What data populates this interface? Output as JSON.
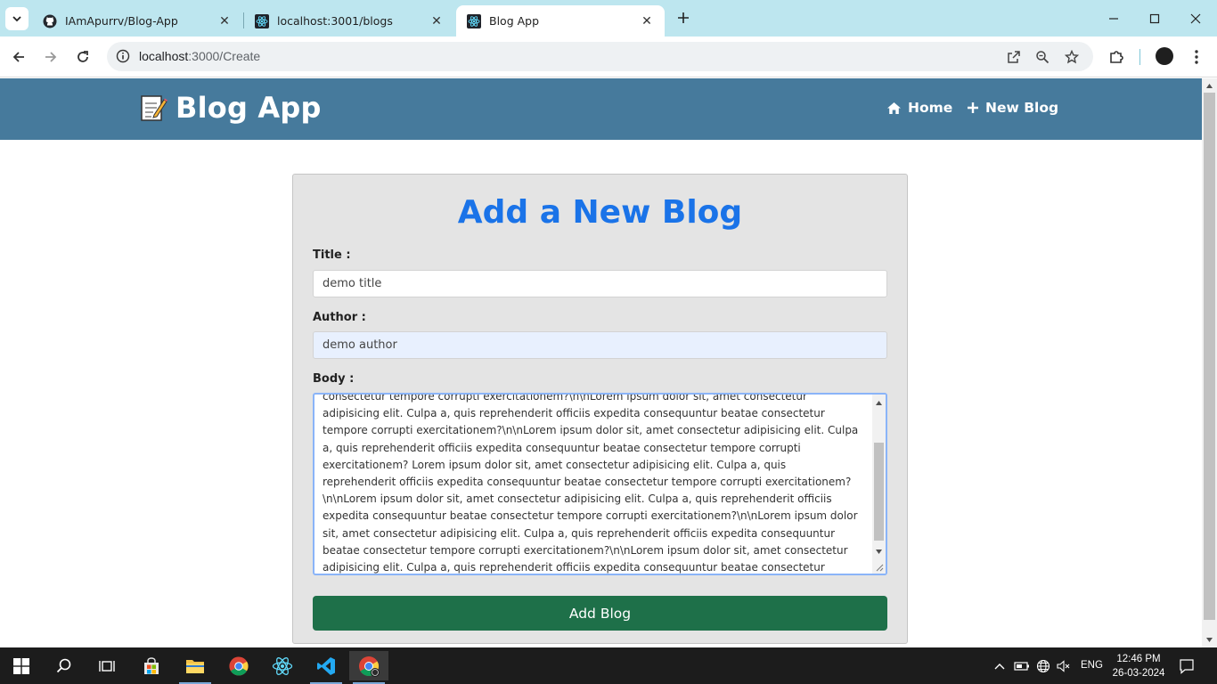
{
  "browser": {
    "tabs": [
      {
        "title": "IAmApurrv/Blog-App",
        "icon": "github-icon",
        "active": false
      },
      {
        "title": "localhost:3001/blogs",
        "icon": "react-icon",
        "active": false
      },
      {
        "title": "Blog App",
        "icon": "react-icon",
        "active": true
      }
    ],
    "address": {
      "host": "localhost",
      "path": ":3000/Create"
    }
  },
  "app": {
    "brand": "Blog App",
    "brand_icon": "memo-emoji-icon",
    "nav": [
      {
        "label": "Home",
        "icon": "home-icon"
      },
      {
        "label": "New Blog",
        "icon": "plus-icon"
      }
    ]
  },
  "form": {
    "heading": "Add a New Blog",
    "title_label": "Title :",
    "title_value": "demo title",
    "author_label": "Author :",
    "author_value": "demo author",
    "body_label": "Body :",
    "body_value": "consectetur tempore corrupti exercitationem?\\n\\nLorem ipsum dolor sit, amet consectetur adipisicing elit. Culpa a, quis reprehenderit officiis expedita consequuntur beatae consectetur tempore corrupti exercitationem?\\n\\nLorem ipsum dolor sit, amet consectetur adipisicing elit. Culpa a, quis reprehenderit officiis expedita consequuntur beatae consectetur tempore corrupti exercitationem? Lorem ipsum dolor sit, amet consectetur adipisicing elit. Culpa a, quis reprehenderit officiis expedita consequuntur beatae consectetur tempore corrupti exercitationem?\\n\\nLorem ipsum dolor sit, amet consectetur adipisicing elit. Culpa a, quis reprehenderit officiis expedita consequuntur beatae consectetur tempore corrupti exercitationem?\\n\\nLorem ipsum dolor sit, amet consectetur adipisicing elit. Culpa a, quis reprehenderit officiis expedita consequuntur beatae consectetur tempore corrupti exercitationem?\\n\\nLorem ipsum dolor sit, amet consectetur adipisicing elit. Culpa a, quis reprehenderit officiis expedita consequuntur beatae consectetur tempore corrupti exercitationem?",
    "submit_label": "Add Blog"
  },
  "taskbar": {
    "language": "ENG",
    "time": "12:46 PM",
    "date": "26-03-2024"
  },
  "colors": {
    "navbar": "#467a9c",
    "heading": "#1a73e8",
    "button": "#1e7049",
    "tabstrip": "#bde6ef"
  }
}
